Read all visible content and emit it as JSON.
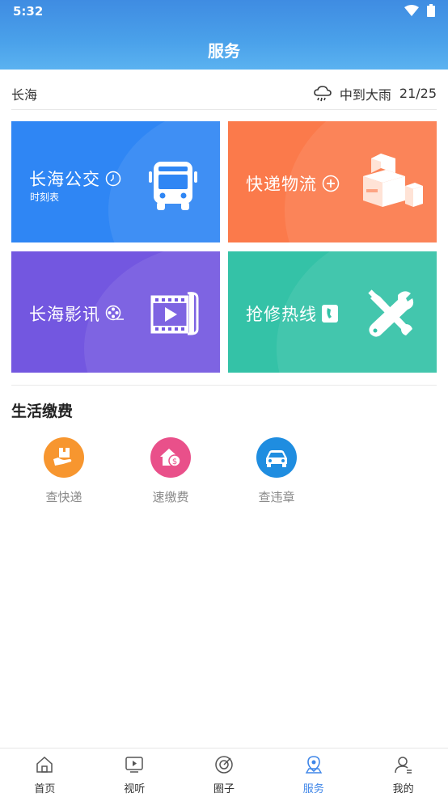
{
  "status": {
    "time": "5:32"
  },
  "header": {
    "title": "服务"
  },
  "weather": {
    "city": "长海",
    "condition": "中到大雨",
    "temp": "21/25"
  },
  "tiles": [
    {
      "title": "长海公交",
      "subtitle": "时刻表"
    },
    {
      "title": "快递物流"
    },
    {
      "title": "长海影讯"
    },
    {
      "title": "抢修热线"
    }
  ],
  "life": {
    "title": "生活缴费",
    "items": [
      {
        "label": "查快递",
        "color": "#f7962f"
      },
      {
        "label": "速缴费",
        "color": "#e9508a"
      },
      {
        "label": "查违章",
        "color": "#1f8de0"
      }
    ]
  },
  "tabs": [
    {
      "label": "首页"
    },
    {
      "label": "视听"
    },
    {
      "label": "圈子"
    },
    {
      "label": "服务"
    },
    {
      "label": "我的"
    }
  ],
  "colors": {
    "accent": "#3f86e8",
    "bus": "#2f86f4",
    "express": "#fb7a4b",
    "film": "#7357e0",
    "repair": "#34c2a7"
  }
}
